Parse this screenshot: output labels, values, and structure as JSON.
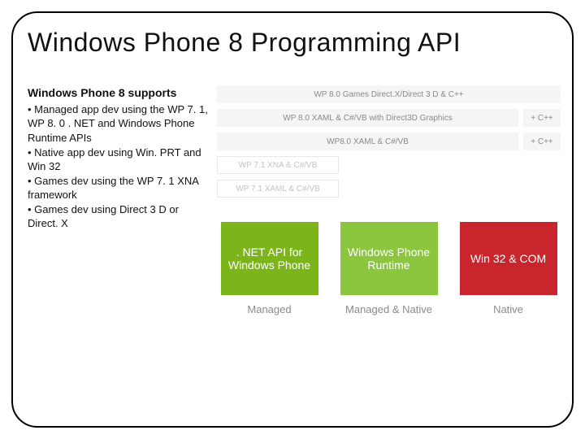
{
  "title": "Windows Phone 8 Programming API",
  "subhead": "Windows Phone 8 supports",
  "bullets": [
    "• Managed app dev using the WP 7. 1, WP 8. 0 . NET and Windows Phone Runtime APIs",
    "• Native app dev using Win. PRT and Win 32",
    "• Games dev using the WP 7. 1 XNA framework",
    "• Games dev using Direct 3 D or Direct. X"
  ],
  "bars": [
    {
      "main": "WP 8.0 Games Direct.X/Direct 3 D & C++",
      "cap": "",
      "style": "light",
      "capStyle": "none"
    },
    {
      "main": "WP 8.0 XAML & C#/VB with Direct3D Graphics",
      "cap": "+ C++",
      "style": "light",
      "capStyle": "light"
    },
    {
      "main": "WP8.0 XAML & C#/VB",
      "cap": "+ C++",
      "style": "light",
      "capStyle": "light"
    },
    {
      "main": "WP 7.1 XNA & C#/VB",
      "cap": "",
      "style": "white",
      "capStyle": "none",
      "short": true
    },
    {
      "main": "WP 7.1 XAML & C#/VB",
      "cap": "",
      "style": "white",
      "capStyle": "none",
      "short": true
    }
  ],
  "apis": [
    {
      "box": ". NET API for Windows Phone",
      "label": "Managed",
      "color": "g"
    },
    {
      "box": "Windows Phone Runtime",
      "label": "Managed & Native",
      "color": "g2"
    },
    {
      "box": "Win 32 & COM",
      "label": "Native",
      "color": "r"
    }
  ]
}
